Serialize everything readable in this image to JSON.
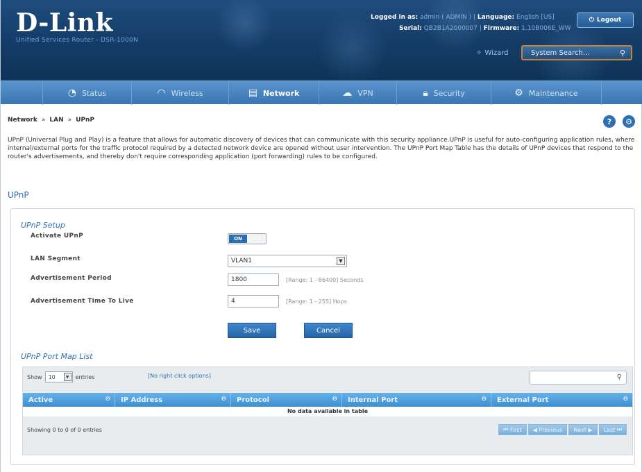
{
  "header": {
    "brand": "D-Link",
    "subtitle": "Unified Services Router - DSR-1000N",
    "logged_in_label": "Logged in as:",
    "logged_in_value": "admin ( ADMIN )",
    "language_label": "Language:",
    "language_value": "English [US]",
    "serial_label": "Serial:",
    "serial_value": "QB2B1A2000007",
    "firmware_label": "Firmware:",
    "firmware_value": "1.10B006E_WW",
    "logout_label": "Logout",
    "wizard_label": "Wizard",
    "system_search_placeholder": "System Search..."
  },
  "nav": {
    "tabs": [
      {
        "label": "Status",
        "icon": "status-icon"
      },
      {
        "label": "Wireless",
        "icon": "wireless-icon"
      },
      {
        "label": "Network",
        "icon": "network-icon",
        "active": true
      },
      {
        "label": "VPN",
        "icon": "vpn-icon"
      },
      {
        "label": "Security",
        "icon": "security-icon"
      },
      {
        "label": "Maintenance",
        "icon": "maintenance-icon"
      }
    ]
  },
  "breadcrumb": {
    "items": [
      "Network",
      "LAN",
      "UPnP"
    ],
    "separator": "»"
  },
  "description": "UPnP (Universal Plug and Play) is a feature that allows for automatic discovery of devices that can communicate with this security appliance.UPnP is useful for auto-configuring application rules, where internal/external ports for the traffic protocol required by a detected network device are opened without user intervention. The UPnP Port Map Table has the details of UPnP devices that respond to the router's advertisements, and thereby don't require corresponding application (port forwarding) rules to be configured.",
  "section_title": "UPnP",
  "setup": {
    "title": "UPnP Setup",
    "activate_label": "Activate UPnP",
    "activate_state": "ON",
    "lan_segment_label": "LAN Segment",
    "lan_segment_value": "VLAN1",
    "adv_period_label": "Advertisement Period",
    "adv_period_value": "1800",
    "adv_period_hint": "[Range: 1 - 86400] Seconds",
    "adv_ttl_label": "Advertisement Time To Live",
    "adv_ttl_value": "4",
    "adv_ttl_hint": "[Range: 1 - 255] Hops",
    "save_label": "Save",
    "cancel_label": "Cancel"
  },
  "port_map": {
    "title": "UPnP Port Map List",
    "show_label": "Show",
    "show_value": "10",
    "entries_label": "entries",
    "no_right_click": "[No right click options]",
    "columns": [
      "Active",
      "IP Address",
      "Protocol",
      "Internal Port",
      "External Port"
    ],
    "empty_message": "No data available in table",
    "info": "Showing 0 to 0 of 0 entries",
    "pager": [
      "First",
      "Previous",
      "Next",
      "Last"
    ]
  }
}
